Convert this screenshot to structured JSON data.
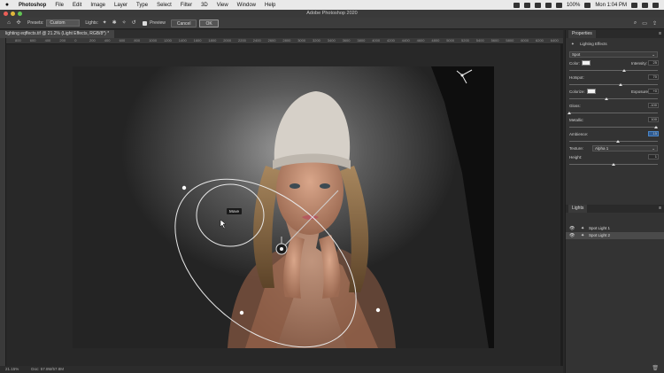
{
  "menubar": {
    "items": [
      "Photoshop",
      "File",
      "Edit",
      "Image",
      "Layer",
      "Type",
      "Select",
      "Filter",
      "3D",
      "View",
      "Window",
      "Help"
    ],
    "battery": "100%",
    "clock": "Mon 1:04 PM"
  },
  "window": {
    "title": "Adobe Photoshop 2020"
  },
  "options": {
    "presets_label": "Presets:",
    "presets_value": "Custom",
    "lights_label": "Lights:",
    "preview_label": "Preview",
    "cancel_label": "Cancel",
    "ok_label": "OK"
  },
  "document": {
    "tab_title": "lighting eqffects.tif @ 21.2% (Light Effects, RGB/8*) *"
  },
  "ruler": {
    "ticks": [
      "800",
      "600",
      "400",
      "200",
      "0",
      "200",
      "400",
      "600",
      "800",
      "1000",
      "1200",
      "1400",
      "1600",
      "1800",
      "2000",
      "2200",
      "2400",
      "2600",
      "2800",
      "3000",
      "3200",
      "3400",
      "3600",
      "3800",
      "4000",
      "4200",
      "4400",
      "4600",
      "4800",
      "5000",
      "5200",
      "5400",
      "5600",
      "5800",
      "6000",
      "6200",
      "6400"
    ]
  },
  "canvas": {
    "tooltip": "Move"
  },
  "statusbar": {
    "zoom": "21.15%",
    "doc": "Doc: 57.8M/57.8M"
  },
  "properties": {
    "tab": "Properties",
    "header": "Lighting Effects",
    "light_type": "Spot",
    "color_label": "Color:",
    "intensity_label": "Intensity:",
    "intensity_value": "25",
    "intensity_level": 0.62,
    "hotspot_label": "Hotspot:",
    "hotspot_value": "70",
    "hotspot_level": 0.58,
    "colorize_label": "Colorize:",
    "exposure_label": "Exposure:",
    "exposure_value": "+0",
    "exposure_level": 0.42,
    "gloss_label": "Gloss:",
    "gloss_value": "-100",
    "gloss_level": 0.0,
    "metallic_label": "Metallic:",
    "metallic_value": "100",
    "metallic_level": 0.98,
    "ambience_label": "Ambience:",
    "ambience_value": "15",
    "ambience_level": 0.55,
    "texture_label": "Texture:",
    "texture_value": "Alpha 1",
    "height_label": "Height:",
    "height_value": "1",
    "height_level": 0.5
  },
  "lights_panel": {
    "tab": "Lights",
    "items": [
      {
        "name": "Spot Light 1",
        "selected": false
      },
      {
        "name": "Spot Light 2",
        "selected": true
      }
    ]
  },
  "colors": {
    "accent": "#4a86c8",
    "ok_border": "#9a9a9a",
    "close": "#ec5f57",
    "minimize": "#e0b73b",
    "zoom": "#62c554"
  }
}
